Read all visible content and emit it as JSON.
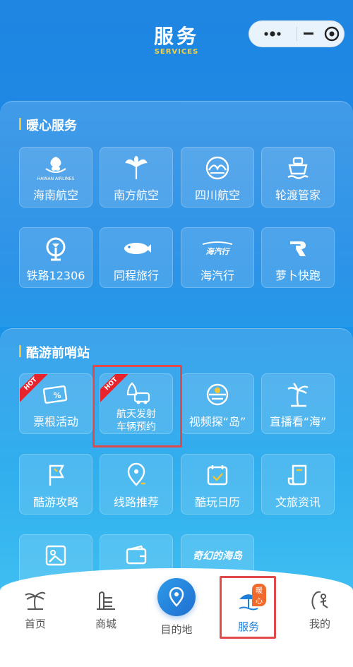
{
  "header": {
    "title": "服务",
    "subtitle": "SERVICES"
  },
  "sections": {
    "warm": {
      "title": "暖心服务",
      "items": [
        {
          "label": "海南航空",
          "icon": "hainan-airlines-logo",
          "logo_text": "HAINAN AIRLINES"
        },
        {
          "label": "南方航空",
          "icon": "china-southern-logo"
        },
        {
          "label": "四川航空",
          "icon": "sichuan-airlines-logo"
        },
        {
          "label": "轮渡管家",
          "icon": "ferry-icon"
        },
        {
          "label": "铁路12306",
          "icon": "railway-logo"
        },
        {
          "label": "同程旅行",
          "icon": "tongcheng-logo"
        },
        {
          "label": "海汽行",
          "icon": "haiqi-logo",
          "logo_text": "海汽行"
        },
        {
          "label": "萝卜快跑",
          "icon": "luobo-logo"
        }
      ]
    },
    "cool": {
      "title": "酷游前哨站",
      "hot_label": "HOT",
      "items": [
        {
          "label": "票根活动",
          "icon": "ticket-icon",
          "hot": true
        },
        {
          "label": "航天发射",
          "label2": "车辆预约",
          "icon": "rocket-car-icon",
          "hot": true
        },
        {
          "label": "视频探“岛”",
          "icon": "video-island-icon"
        },
        {
          "label": "直播看“海”",
          "icon": "palm-tree-icon"
        },
        {
          "label": "酷游攻略",
          "icon": "flag-icon"
        },
        {
          "label": "线路推荐",
          "icon": "location-route-icon"
        },
        {
          "label": "酷玩日历",
          "icon": "calendar-check-icon"
        },
        {
          "label": "文旅资讯",
          "icon": "news-scroll-icon"
        },
        {
          "label": "",
          "icon": "photo-map-icon"
        },
        {
          "label": "",
          "icon": "wallet-icon"
        },
        {
          "label": "",
          "icon": "fantasy-island-logo",
          "logo_text": "奇幻的海岛"
        }
      ]
    }
  },
  "tabbar": [
    {
      "label": "首页",
      "icon": "palm-tree-icon"
    },
    {
      "label": "商城",
      "icon": "building-icon"
    },
    {
      "label": "目的地",
      "icon": "location-pin-icon"
    },
    {
      "label": "服务",
      "icon": "beach-umbrella-icon",
      "badge": "暖心",
      "active": true
    },
    {
      "label": "我的",
      "icon": "surfer-icon"
    }
  ],
  "colors": {
    "accent": "#f4c636",
    "active_tab": "#1e7fd8",
    "hot": "#e8232b",
    "highlight": "#e04a4a"
  }
}
